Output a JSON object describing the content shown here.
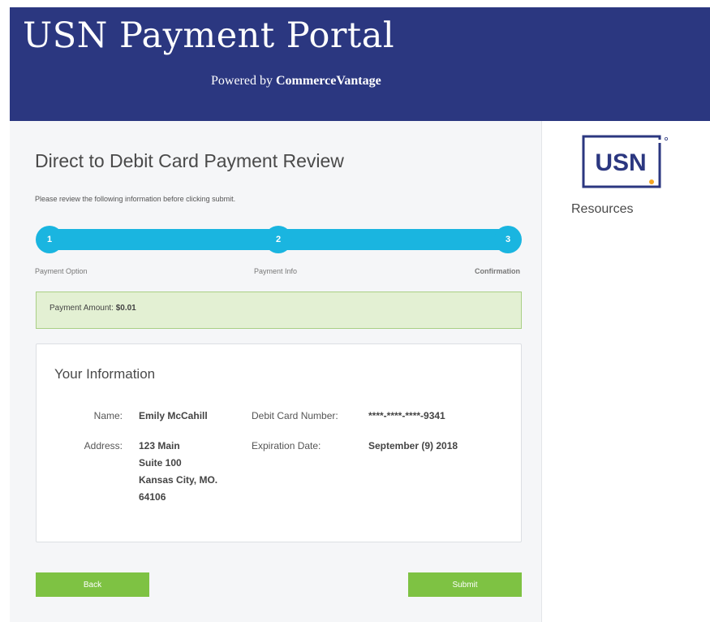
{
  "header": {
    "title": "USN Payment Portal",
    "powered_prefix": "Powered by",
    "powered_brand": "CommerceVantage"
  },
  "main": {
    "title": "Direct to Debit Card Payment Review",
    "intro": "Please review the following information before clicking submit.",
    "steps": [
      {
        "number": "1",
        "label": "Payment Option"
      },
      {
        "number": "2",
        "label": "Payment Info"
      },
      {
        "number": "3",
        "label": "Confirmation"
      }
    ],
    "amount": {
      "label": "Payment Amount:",
      "value": "$0.01"
    },
    "info": {
      "title": "Your Information",
      "name_label": "Name:",
      "name_value": "Emily McCahill",
      "address_label": "Address:",
      "address_lines": [
        "123 Main",
        "Suite 100",
        "Kansas City, MO.",
        "64106"
      ],
      "card_label": "Debit Card Number:",
      "card_value": "****-****-****-9341",
      "exp_label": "Expiration Date:",
      "exp_value": "September (9) 2018"
    },
    "buttons": {
      "back": "Back",
      "submit": "Submit"
    }
  },
  "sidebar": {
    "logo_text": "USN",
    "resources": "Resources"
  },
  "colors": {
    "header_bg": "#2b3780",
    "stepper": "#1ab5e0",
    "button": "#7ec243",
    "amount_bg": "#e3f0d3",
    "logo_blue": "#2b3780",
    "logo_accent": "#f5a623"
  }
}
